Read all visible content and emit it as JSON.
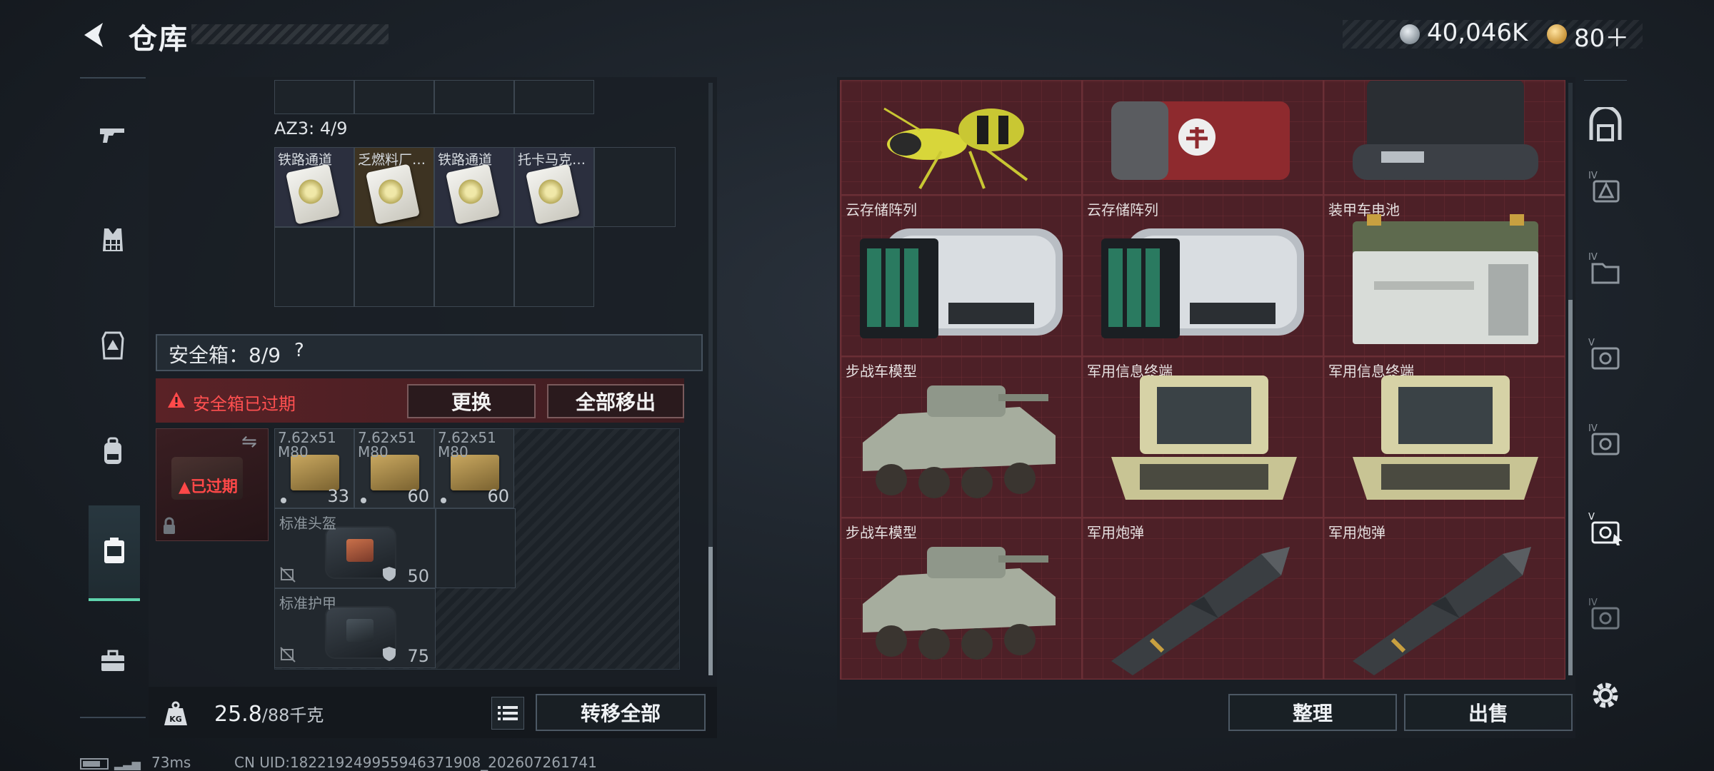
{
  "header": {
    "title": "仓库",
    "currency_a": "40,046K",
    "currency_b": "80＋"
  },
  "left_nav": {
    "items": [
      "gun-icon",
      "vest-icon",
      "armor-icon",
      "backpack-icon",
      "safebox-icon",
      "briefcase-icon"
    ],
    "active_index": 4
  },
  "key_container": {
    "label": "AZ3: 4/9",
    "keys": [
      {
        "name": "铁路通道",
        "bg": "#2b2f3e"
      },
      {
        "name": "乏燃料厂…",
        "bg": "#3d3322"
      },
      {
        "name": "铁路通道",
        "bg": "#2b2f3e"
      },
      {
        "name": "托卡马克…",
        "bg": "#2b2f3e"
      }
    ]
  },
  "safe_box": {
    "label": "安全箱：8/9",
    "help": "?",
    "expired_message": "安全箱已过期",
    "swap_button": "更换",
    "move_all_button": "全部移出",
    "box_status": "已过期",
    "ammo": [
      {
        "name": "7.62x51\nM80",
        "count": "33"
      },
      {
        "name": "7.62x51\nM80",
        "count": "60"
      },
      {
        "name": "7.62x51\nM80",
        "count": "60"
      }
    ],
    "gear": [
      {
        "name": "标准头盔",
        "durability": "50"
      },
      {
        "name": "标准护甲",
        "durability": "75"
      }
    ]
  },
  "bottom_bar": {
    "weight_current": "25.8",
    "weight_max": "/88千克",
    "transfer_button": "转移全部"
  },
  "storage": {
    "row0": [
      "",
      "",
      ""
    ],
    "row1": [
      "云存储阵列",
      "云存储阵列",
      "装甲车电池"
    ],
    "row2": [
      "步战车模型",
      "军用信息终端",
      "军用信息终端"
    ],
    "row3": [
      "步战车模型",
      "军用炮弹",
      "军用炮弹"
    ],
    "sort_button": "整理",
    "sell_button": "出售"
  },
  "right_rail": {
    "items": [
      "vault-icon",
      "tier4-warning-icon",
      "tier4-folder-icon",
      "tier5-safe-icon",
      "tier4-safe-icon",
      "tier5-safe-cursor-icon",
      "tier4-safe-icon"
    ],
    "tier_labels": [
      "",
      "IV",
      "IV",
      "V",
      "IV",
      "V",
      "IV"
    ]
  },
  "footer": {
    "ping": "73ms",
    "uid": "CN UID:18221924995594637190​8_202607261741"
  },
  "colors": {
    "accent": "#5fd4ad",
    "danger": "#ff5050",
    "storage_bg": "#4d2027"
  }
}
